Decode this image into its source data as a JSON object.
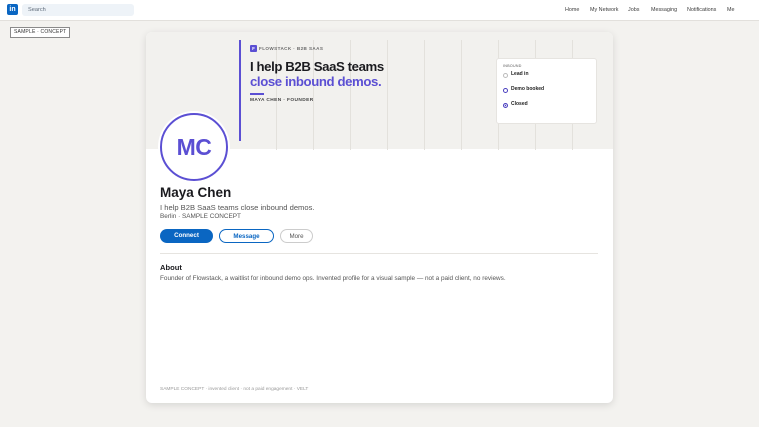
{
  "nav": {
    "logo": "in",
    "search_placeholder": "Search",
    "links": [
      "Home",
      "My Network",
      "Jobs",
      "Messaging",
      "Notifications",
      "Me"
    ]
  },
  "badge": "SAMPLE · CONCEPT",
  "banner": {
    "brand_mark": "F",
    "brand": "FLOWSTACK · B2B SAAS",
    "headline_1": "I help B2B SaaS teams",
    "headline_2": "close inbound demos.",
    "byline": "MAYA CHEN · FOUNDER",
    "panel": {
      "title": "INBOUND",
      "items": [
        "Lead in",
        "Demo booked",
        "Closed"
      ]
    }
  },
  "profile": {
    "initials": "MC",
    "name": "Maya Chen",
    "tagline": "I help B2B SaaS teams close inbound demos.",
    "location": "Berlin · SAMPLE CONCEPT",
    "actions": {
      "connect": "Connect",
      "message": "Message",
      "more": "More"
    }
  },
  "about": {
    "heading": "About",
    "text": "Founder of Flowstack, a waitlist for inbound demo ops. Invented profile for a visual sample — not a paid client, no reviews."
  },
  "footer": "SAMPLE CONCEPT · invented client · not a paid engagement · VELT",
  "colors": {
    "brand_blue": "#0a66c2",
    "accent_purple": "#5b4fd3",
    "page_bg": "#f3f2ef"
  }
}
